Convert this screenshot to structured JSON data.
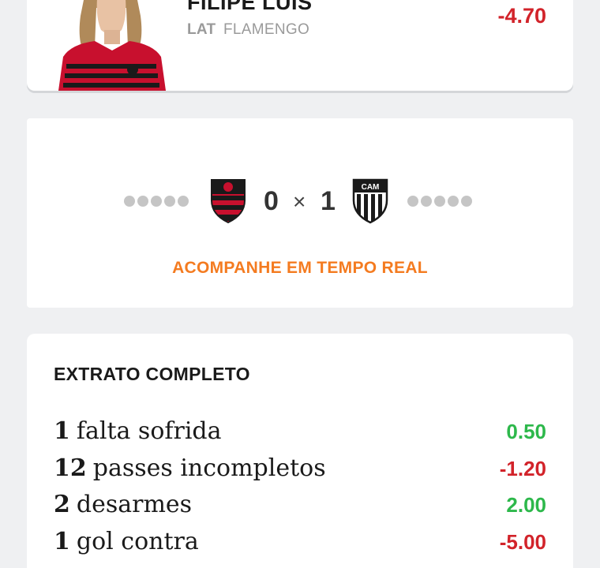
{
  "player": {
    "name": "FILIPE LUÍS",
    "position": "LAT",
    "team": "FLAMENGO",
    "score": "-4.70"
  },
  "match": {
    "home_team": "Flamengo",
    "away_team": "Atlético Mineiro",
    "away_crest_text": "CAM",
    "home_score": "0",
    "separator": "×",
    "away_score": "1",
    "link_label": "ACOMPANHE EM TEMPO REAL"
  },
  "statement": {
    "title": "EXTRATO COMPLETO",
    "items": [
      {
        "count": "1",
        "label": "falta sofrida",
        "value": "0.50",
        "color": "#2db84b"
      },
      {
        "count": "12",
        "label": "passes incompletos",
        "value": "-1.20",
        "color": "#d2232a"
      },
      {
        "count": "2",
        "label": "desarmes",
        "value": "2.00",
        "color": "#2db84b"
      },
      {
        "count": "1",
        "label": "gol contra",
        "value": "-5.00",
        "color": "#d2232a"
      }
    ]
  },
  "colors": {
    "positive": "#2db84b",
    "negative": "#d2232a",
    "accent": "#f47b20"
  }
}
